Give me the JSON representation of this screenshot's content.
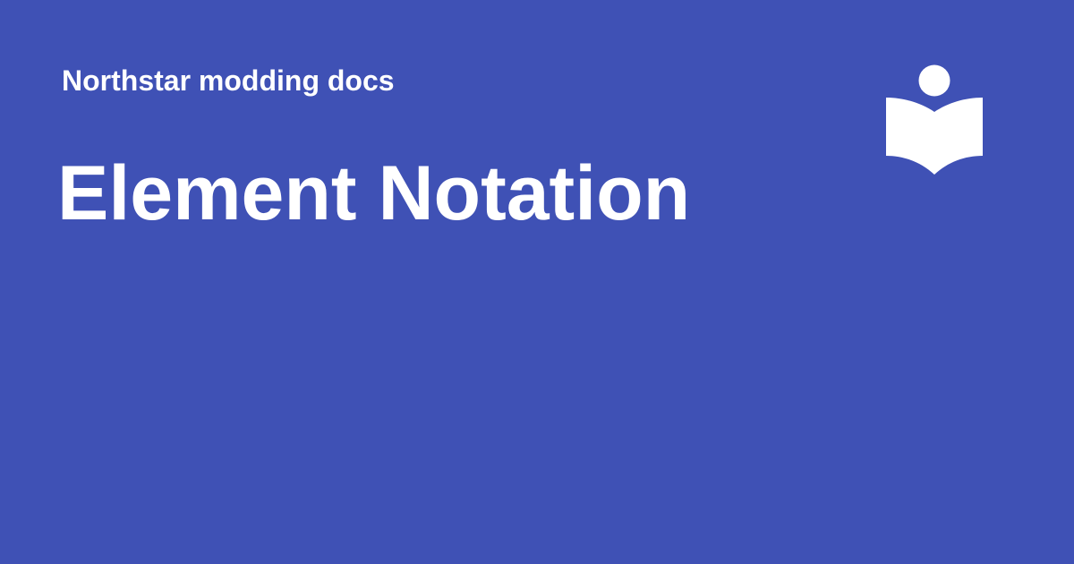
{
  "site": {
    "name": "Northstar modding docs"
  },
  "page": {
    "title": "Element Notation"
  },
  "logo": {
    "icon": "book-reader-icon"
  },
  "colors": {
    "background": "#3f51b5",
    "text": "#ffffff"
  }
}
